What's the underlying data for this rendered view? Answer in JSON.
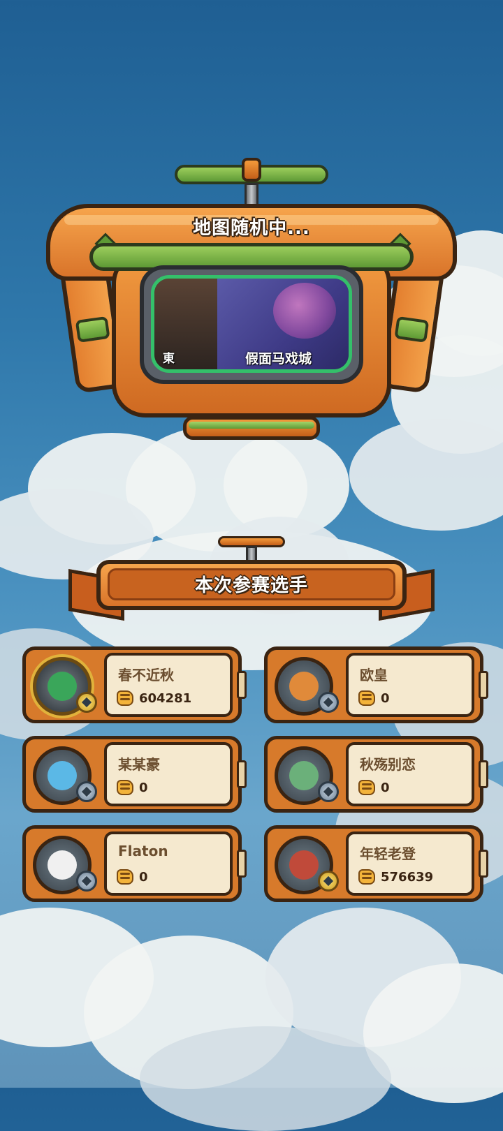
{
  "status": {
    "title": "地图随机中..."
  },
  "map_preview": {
    "left_label": "東",
    "right_label": "假面马戏城"
  },
  "participants": {
    "title": "本次参赛选手"
  },
  "players": [
    {
      "name": "春不近秋",
      "score": "604281",
      "face_color": "#3aa65a",
      "frame": "gold"
    },
    {
      "name": "欧皇",
      "score": "0",
      "face_color": "#e08a3a",
      "frame": "silver"
    },
    {
      "name": "某某豪",
      "score": "0",
      "face_color": "#5bb8e6",
      "frame": "silver"
    },
    {
      "name": "秋殇别恋",
      "score": "0",
      "face_color": "#6bb07a",
      "frame": "silver"
    },
    {
      "name": "Flaton",
      "score": "0",
      "face_color": "#f0f0f0",
      "frame": "silver"
    },
    {
      "name": "年轻老登",
      "score": "576639",
      "face_color": "#c04a3a",
      "frame": "gold-badge"
    }
  ],
  "icons": {
    "score": "fist-icon",
    "rank": "rank-badge-icon"
  }
}
